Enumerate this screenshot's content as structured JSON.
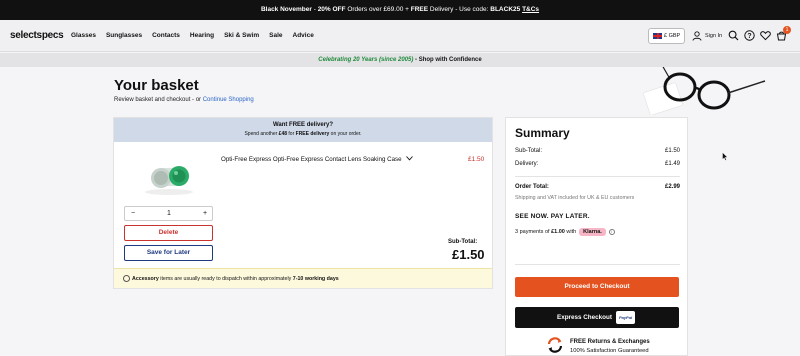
{
  "topbar": {
    "event": "Black November",
    "offer": "20% OFF",
    "orders_text": "Orders over £69.00",
    "free": "FREE",
    "delivery": "Delivery",
    "use_code": "- Use code:",
    "code": "BLACK25",
    "tcs": "T&Cs"
  },
  "nav": {
    "logo": "selectspecs",
    "menu": [
      "Glasses",
      "Sunglasses",
      "Contacts",
      "Hearing",
      "Ski & Swim",
      "Sale",
      "Advice"
    ],
    "currency": "£ GBP",
    "sign_in": "Sign In",
    "cart_count": "1"
  },
  "promo": {
    "celebrating": "Celebrating 20 Years (since 2005)",
    "shop": " - Shop with Confidence"
  },
  "basket": {
    "title": "Your basket",
    "subtitle": "Review basket and checkout - or",
    "continue_link": "Continue Shopping",
    "free_delivery_title": "Want FREE delivery?",
    "free_delivery_pre": "Spend another ",
    "free_delivery_amount": "£48",
    "free_delivery_mid": " for ",
    "free_delivery_bold": "FREE delivery",
    "free_delivery_post": " on your order.",
    "product_name": "Opti-Free Express Opti-Free Express Contact Lens Soaking Case",
    "product_price": "£1.50",
    "quantity": "1",
    "qty_minus": "−",
    "qty_plus": "+",
    "delete_label": "Delete",
    "save_later_label": "Save for Later",
    "subtotal_label": "Sub-Total:",
    "subtotal_value": "£1.50",
    "notice_bold": "Accessory",
    "notice_text": " items are usually ready to dispatch within approximately ",
    "notice_days": "7-10 working days"
  },
  "summary": {
    "title": "Summary",
    "subtotal_label": "Sub-Total:",
    "subtotal_value": "£1.50",
    "delivery_label": "Delivery:",
    "delivery_value": "£1.49",
    "order_total_label": "Order Total:",
    "order_total_value": "£2.99",
    "shipping_note": "Shipping and VAT included for UK & EU customers",
    "see_now": "SEE NOW. PAY LATER.",
    "klarna_pre": "3 payments of",
    "klarna_amount": "£1.00",
    "klarna_with": "with",
    "klarna_brand": "Klarna.",
    "klarna_info": "i",
    "checkout_label": "Proceed to Checkout",
    "express_label": "Express Checkout",
    "paypal_label": "PayPal",
    "returns_title": "FREE Returns & Exchanges",
    "returns_sub": "100% Satisfaction Guaranteed"
  },
  "colors": {
    "accent_orange": "#e3521f",
    "price_red": "#c8332e",
    "link_blue": "#2a64c5",
    "promo_green": "#1f8a3a"
  }
}
